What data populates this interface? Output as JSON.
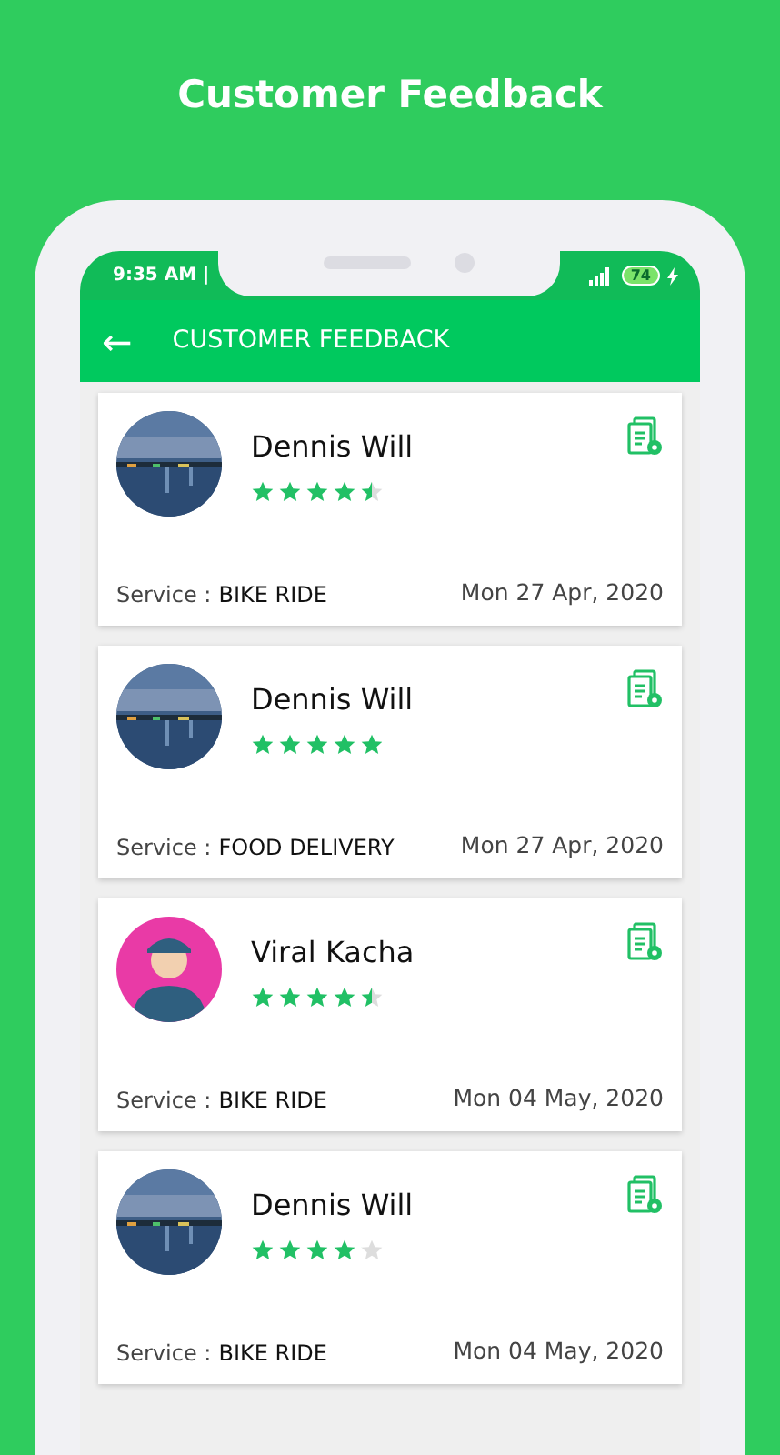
{
  "page_title": "Customer Feedback",
  "status_bar": {
    "time": "9:35 AM |",
    "battery": "74"
  },
  "app_bar": {
    "back": "←",
    "title": "CUSTOMER FEEDBACK"
  },
  "feedback": [
    {
      "name": "Dennis Will",
      "kind": "picture",
      "stars": 4.5,
      "service_label": "Service :",
      "service": "BIKE RIDE",
      "date": "Mon 27 Apr, 2020"
    },
    {
      "name": "Dennis Will",
      "kind": "picture",
      "stars": 5,
      "service_label": "Service :",
      "service": "FOOD DELIVERY",
      "date": "Mon 27 Apr, 2020"
    },
    {
      "name": "Viral Kacha",
      "kind": "figure",
      "stars": 4.5,
      "service_label": "Service :",
      "service": "BIKE RIDE",
      "date": "Mon 04 May, 2020"
    },
    {
      "name": "Dennis Will",
      "kind": "picture",
      "stars": 4,
      "service_label": "Service :",
      "service": "BIKE RIDE",
      "date": "Mon 04 May, 2020"
    }
  ]
}
